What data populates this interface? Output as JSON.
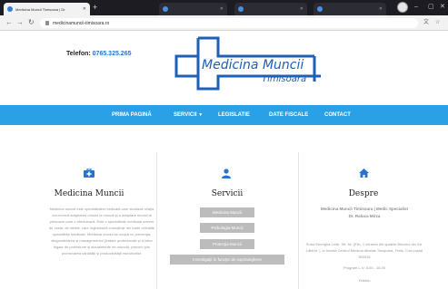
{
  "browser": {
    "active_tab_title": "Medicina Muncii Timisoara | Dr.",
    "url": "medicinamuncii-timisoara.ro",
    "background_tabs": [
      "",
      "",
      "",
      ""
    ],
    "icons": {
      "back": "arrow-left-icon",
      "forward": "arrow-right-icon",
      "reload": "reload-icon",
      "lock": "lock-icon",
      "translate": "translate-icon",
      "star": "star-icon",
      "new_tab": "plus-icon"
    }
  },
  "header": {
    "phone_label": "Telefon:",
    "phone_number": "0765.325.265",
    "logo_name": "Medicina Muncii",
    "logo_city": "Timisoara"
  },
  "nav": {
    "items": [
      "PRIMA PAGINĂ",
      "SERVICII",
      "LEGISLATIE",
      "DATE FISCALE",
      "CONTACT"
    ]
  },
  "columns": {
    "medicina": {
      "icon": "medical-kit-icon",
      "title": "Medicina Muncii",
      "text": "Medicina muncii este specialitatea medicală care studiază relaţia om-muncă adaptarea omului la muncă şi a adaptare muncii la persoane care o efectuează. Este o specialitate medicala axtrem de vasta; de relatie, care înglobează cunoştinţe din toate celelalte specialităţi medicale. Medicina muncii se ocupă cu prevenţia, diagnosticarea şi managementul (tratare profesionale şi a celor legate de profesiune şi actualmente de muncă), precum şiru promovarea sănătăţii şi productivităţii muncitorilor."
    },
    "servicii": {
      "icon": "user-icon",
      "title": "Servicii",
      "buttons": [
        "Medicina Muncii",
        "Psihologia Muncii",
        "Protecţia Muncii",
        "Investigaţii în funcţie de supraveghere"
      ]
    },
    "despre": {
      "icon": "home-icon",
      "title": "Despre",
      "subtitle_line1": "Medicina Muncii Timisoara | Medic Specialist",
      "subtitle_line2": "Dr. Raluca Mirza",
      "address": "B-dul Eberigha Ledlr. Str. Nr. (fi3n, 1 intrarea din spatele Blocului din Str. Lăbirid: ), in Incinta Centrul Medical Athelas Timişoara, Timiș, Cod poştal 300034",
      "program": "Program L-V: 8,00 - 18,00",
      "telefon": "Telefon"
    }
  },
  "colors": {
    "nav_bg": "#2aa0e6",
    "logo_blue": "#1f5fb5",
    "service_button": "#bcbcbc"
  }
}
